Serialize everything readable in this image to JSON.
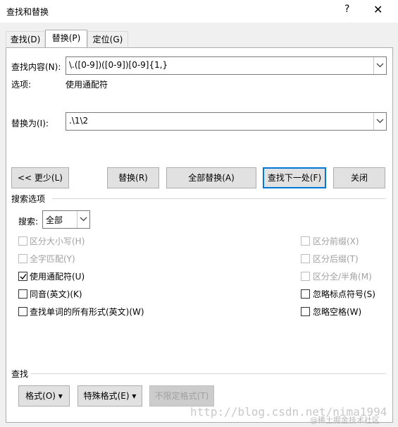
{
  "window": {
    "title": "查找和替换",
    "help_label": "?",
    "close_label": "✕"
  },
  "tabs": [
    {
      "label": "查找(D)"
    },
    {
      "label": "替换(P)"
    },
    {
      "label": "定位(G)"
    }
  ],
  "find": {
    "label": "查找内容(N):",
    "value": "\\.([0-9])([0-9])[0-9]{1,}",
    "options_label": "选项:",
    "options_value": "使用通配符"
  },
  "replace": {
    "label": "替换为(I):",
    "value": ".\\1\\2"
  },
  "buttons": {
    "less": "<< 更少(L)",
    "replace": "替换(R)",
    "replace_all": "全部替换(A)",
    "find_next": "查找下一处(F)",
    "close": "关闭"
  },
  "search_options": {
    "title": "搜索选项",
    "search_label": "搜索:",
    "search_value": "全部"
  },
  "checkboxes_left": [
    {
      "label": "区分大小写(H)",
      "checked": false,
      "disabled": true
    },
    {
      "label": "全字匹配(Y)",
      "checked": false,
      "disabled": true
    },
    {
      "label": "使用通配符(U)",
      "checked": true,
      "disabled": false
    },
    {
      "label": "同音(英文)(K)",
      "checked": false,
      "disabled": false
    },
    {
      "label": "查找单词的所有形式(英文)(W)",
      "checked": false,
      "disabled": false
    }
  ],
  "checkboxes_right": [
    {
      "label": "区分前缀(X)",
      "checked": false,
      "disabled": true
    },
    {
      "label": "区分后缀(T)",
      "checked": false,
      "disabled": true
    },
    {
      "label": "区分全/半角(M)",
      "checked": false,
      "disabled": true
    },
    {
      "label": "忽略标点符号(S)",
      "checked": false,
      "disabled": false
    },
    {
      "label": "忽略空格(W)",
      "checked": false,
      "disabled": false
    }
  ],
  "find_section": {
    "title": "查找",
    "format_btn": "格式(O) ▾",
    "special_btn": "特殊格式(E) ▾",
    "no_format_btn": "不限定格式(T)"
  },
  "watermark": {
    "url": "http://blog.csdn.net/nima1994",
    "credit": "@稀土掘金技术社区"
  }
}
